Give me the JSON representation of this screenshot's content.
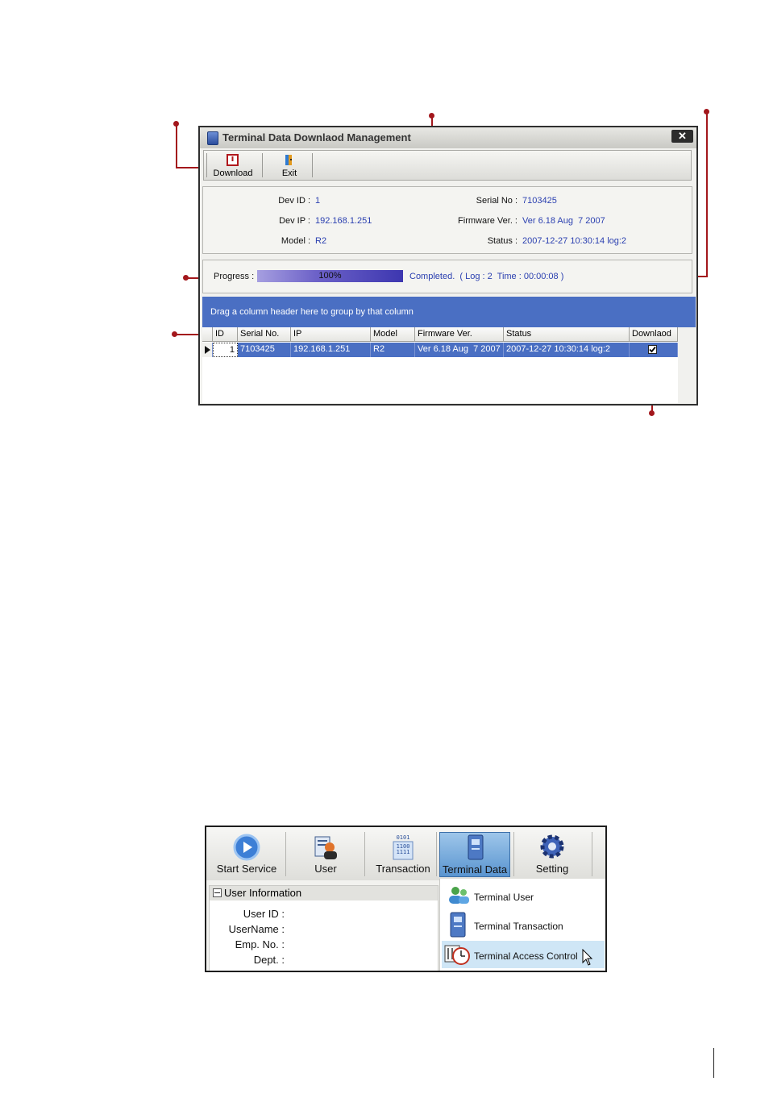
{
  "window": {
    "title": "Terminal Data Downlaod Management",
    "close_glyph": "✕",
    "toolbar": [
      {
        "label": "Download",
        "icon": "download-icon"
      },
      {
        "label": "Exit",
        "icon": "exit-icon"
      }
    ]
  },
  "device_info": {
    "dev_id_label": "Dev ID :",
    "dev_id": "1",
    "dev_ip_label": "Dev IP :",
    "dev_ip": "192.168.1.251",
    "model_label": "Model :",
    "model": "R2",
    "serial_label": "Serial No :",
    "serial": "7103425",
    "firmware_label": "Firmware Ver. :",
    "firmware": "Ver 6.18 Aug  7 2007",
    "status_label": "Status :",
    "status": "2007-12-27 10:30:14 log:2"
  },
  "progress": {
    "label": "Progress :",
    "percent_text": "100%",
    "fraction": 1.0,
    "message": "Completed.  ( Log : 2  Time : 00:00:08 )"
  },
  "grid": {
    "group_hint": "Drag a column header here to group by that column",
    "columns": [
      "ID",
      "Serial No.",
      "IP",
      "Model",
      "Firmware Ver.",
      "Status",
      "Downlaod"
    ],
    "rows": [
      {
        "id": "1",
        "serial": "7103425",
        "ip": "192.168.1.251",
        "model": "R2",
        "firmware": "Ver 6.18 Aug  7 2007",
        "status": "2007-12-27 10:30:14 log:2",
        "download_checked": true
      }
    ]
  },
  "main_menu": {
    "buttons": [
      {
        "label": "Start Service",
        "icon": "play-icon"
      },
      {
        "label": "User",
        "icon": "user-icon"
      },
      {
        "label": "Transaction",
        "icon": "binary-data-icon"
      },
      {
        "label": "Terminal Data",
        "icon": "terminal-data-icon"
      },
      {
        "label": "Setting",
        "icon": "gear-icon"
      }
    ],
    "user_info": {
      "header": "User Information",
      "fields": [
        "User ID :",
        "UserName :",
        "Emp. No. :",
        "Dept. :"
      ]
    },
    "dropdown": [
      {
        "label": "Terminal User",
        "icon": "users-icon"
      },
      {
        "label": "Terminal Transaction",
        "icon": "terminal-icon"
      },
      {
        "label": "Terminal Access Control",
        "icon": "clock-icon"
      }
    ]
  },
  "colors": {
    "callout": "#a3171c",
    "selection": "#4a6fc3",
    "value_text": "#2a3fb0"
  }
}
